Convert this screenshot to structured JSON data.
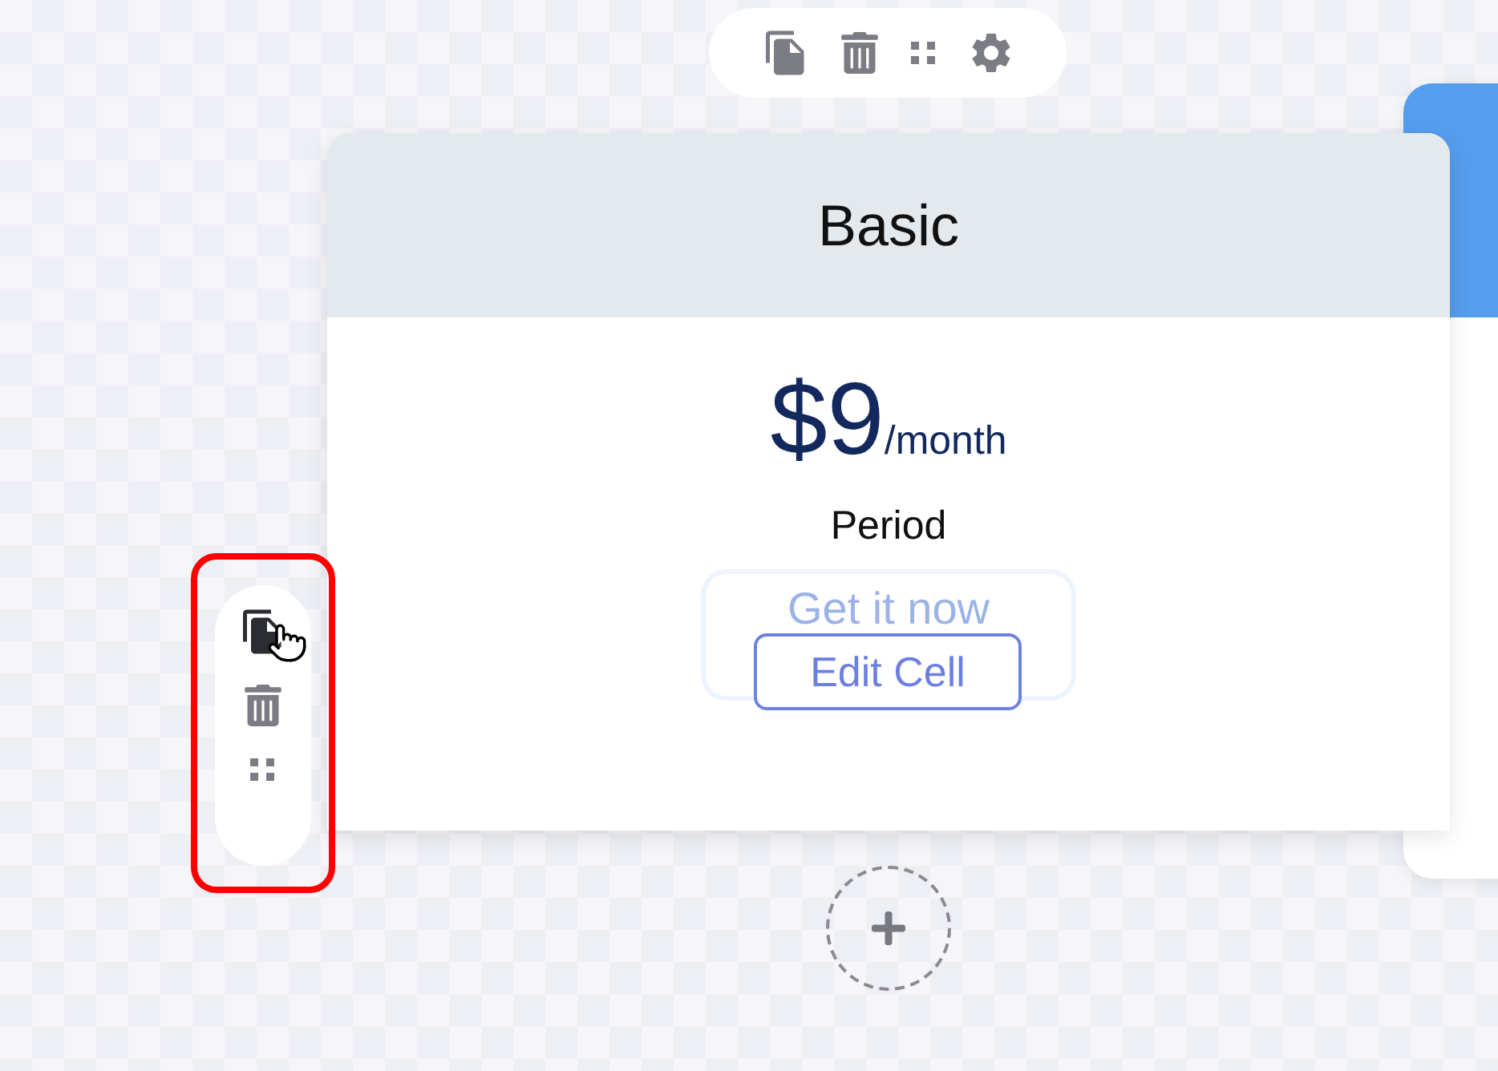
{
  "top_toolbar": {
    "tools": [
      {
        "kind": "copy"
      },
      {
        "kind": "delete"
      },
      {
        "kind": "drag"
      },
      {
        "kind": "settings"
      }
    ]
  },
  "side_toolbar": {
    "highlighted": true,
    "tools": [
      {
        "kind": "copy"
      },
      {
        "kind": "delete"
      },
      {
        "kind": "drag"
      }
    ]
  },
  "card": {
    "title": "Basic",
    "price": "$9",
    "unit": "/month",
    "period": "Period",
    "cta": "Get it now",
    "edit_button": "Edit Cell"
  }
}
